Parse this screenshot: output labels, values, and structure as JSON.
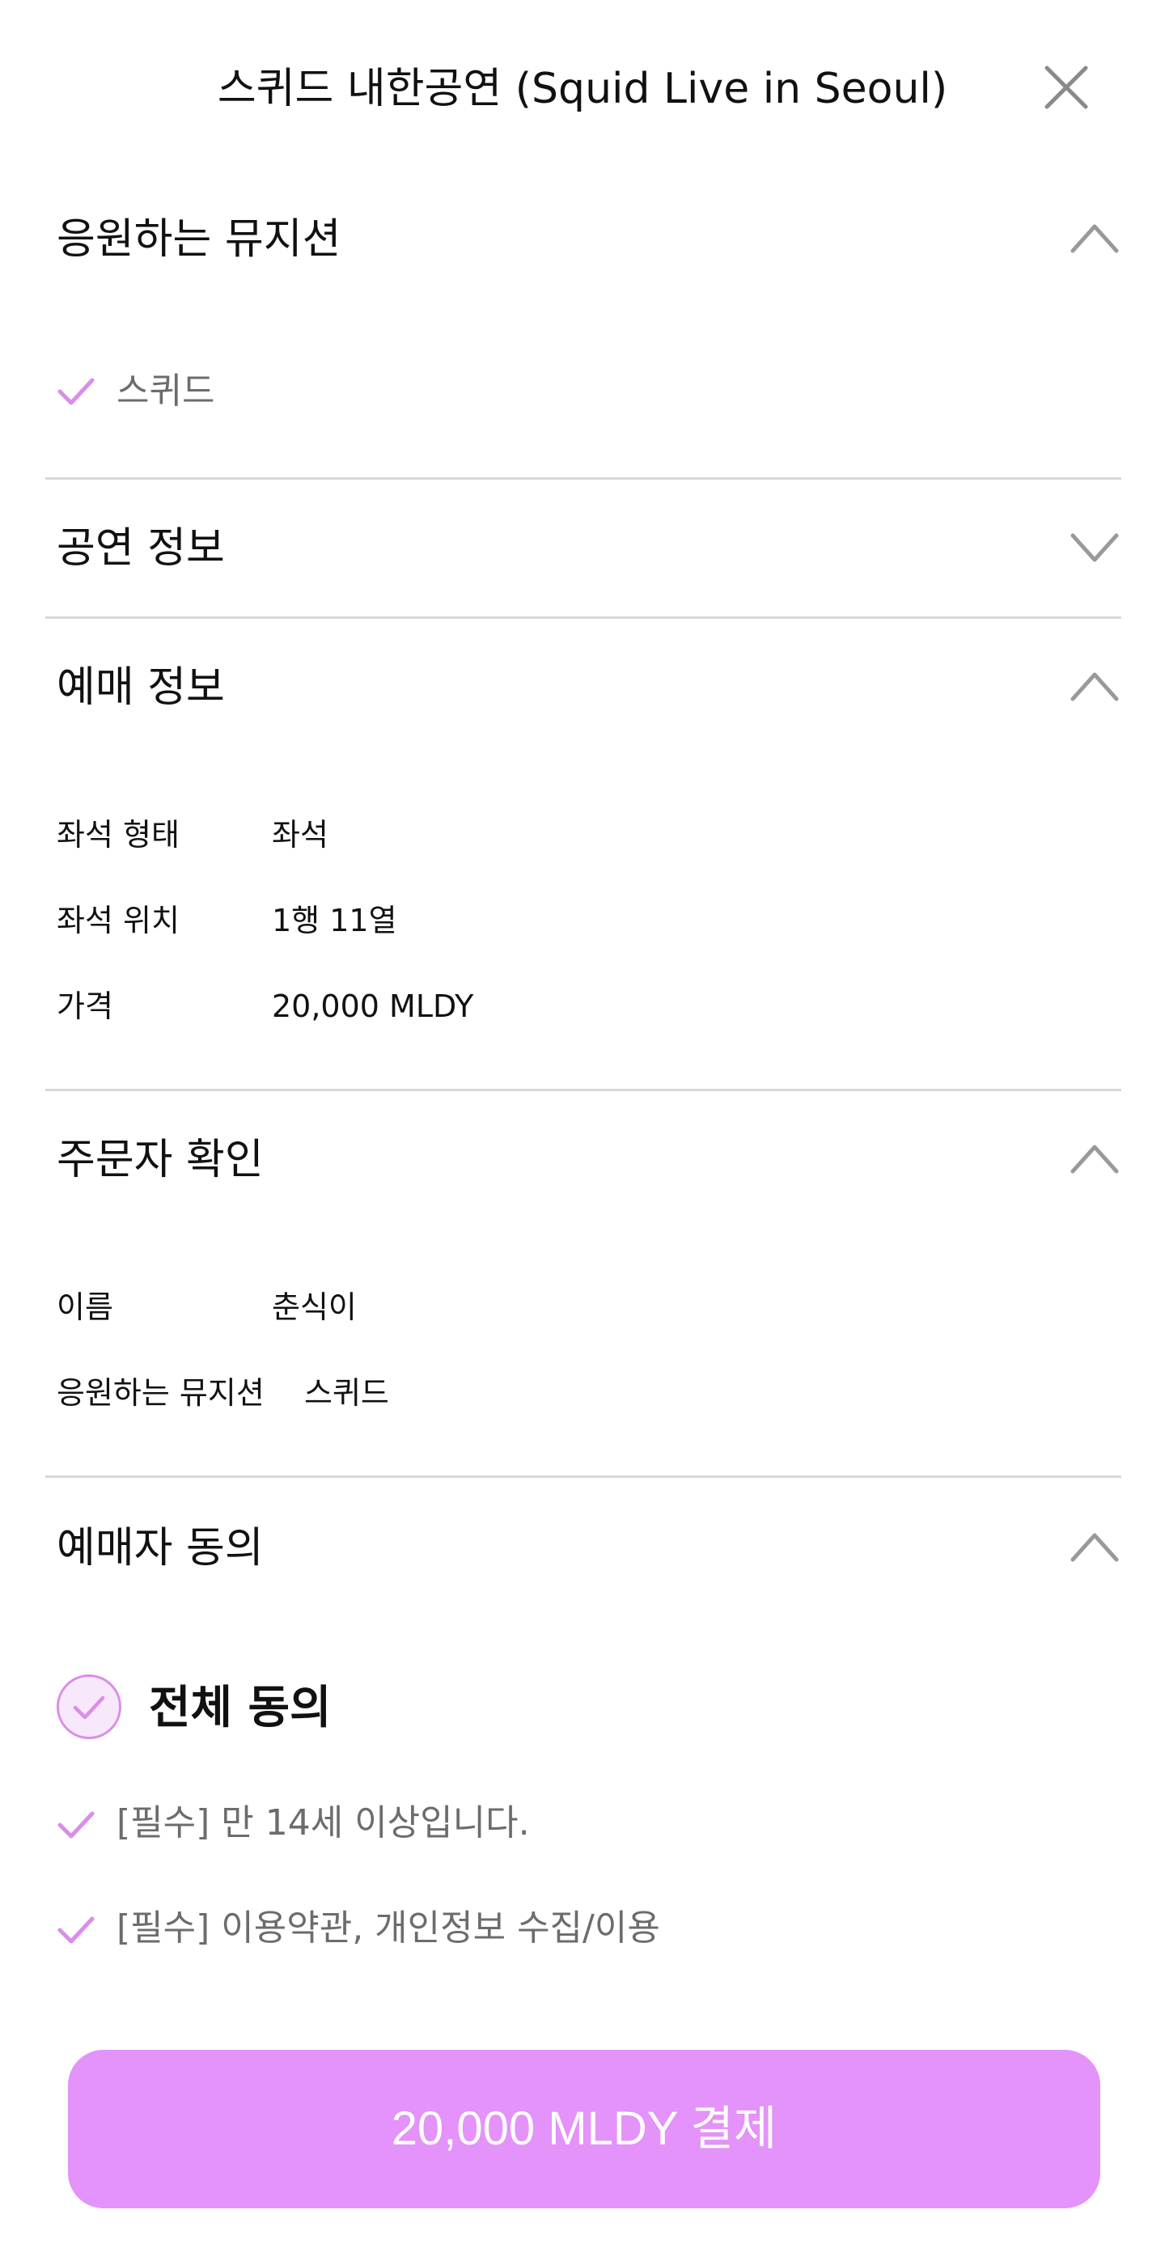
{
  "header": {
    "title": "스퀴드 내한공연 (Squid Live in Seoul)",
    "close_icon": "close-icon"
  },
  "colors": {
    "accent": "#e393f9",
    "check": "#d98ee8",
    "divider": "#d8d8d8",
    "muted_text": "#6c6c6c"
  },
  "sections": {
    "musician": {
      "title": "응원하는 뮤지션",
      "expanded": true,
      "selected": "스퀴드"
    },
    "performance": {
      "title": "공연 정보",
      "expanded": false
    },
    "booking": {
      "title": "예매 정보",
      "expanded": true,
      "rows": [
        {
          "label": "좌석 형태",
          "value": "좌석"
        },
        {
          "label": "좌석 위치",
          "value": "1행 11열"
        },
        {
          "label": "가격",
          "value": "20,000 MLDY"
        }
      ]
    },
    "orderer": {
      "title": "주문자 확인",
      "expanded": true,
      "rows": [
        {
          "label": "이름",
          "value": "춘식이"
        },
        {
          "label": "응원하는 뮤지션",
          "value": "스퀴드"
        }
      ]
    },
    "agreement": {
      "title": "예매자 동의",
      "expanded": true,
      "all_label": "전체 동의",
      "items": [
        "[필수] 만 14세 이상입니다.",
        "[필수] 이용약관, 개인정보 수집/이용"
      ]
    }
  },
  "pay_button": {
    "label": "20,000 MLDY 결제"
  }
}
